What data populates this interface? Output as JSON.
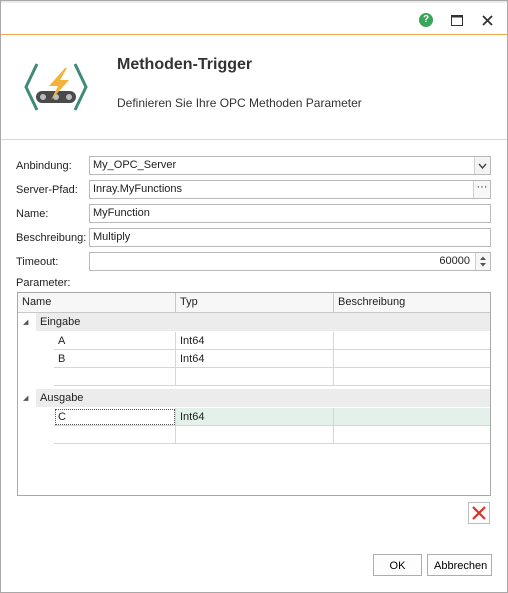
{
  "window": {
    "title": "Methoden-Trigger",
    "subtitle": "Definieren Sie Ihre OPC Methoden Parameter",
    "help_icon": "help-icon",
    "maximize_icon": "maximize-icon",
    "close_icon": "close-icon",
    "accent_color": "#f0a54a"
  },
  "form": {
    "binding": {
      "label": "Anbindung:",
      "value": "My_OPC_Server"
    },
    "server_path": {
      "label": "Server-Pfad:",
      "value": "Inray.MyFunctions",
      "browse_label": "···"
    },
    "name": {
      "label": "Name:",
      "value": "MyFunction"
    },
    "description": {
      "label": "Beschreibung:",
      "value": "Multiply"
    },
    "timeout": {
      "label": "Timeout:",
      "value": "60000"
    },
    "parameters_label": "Parameter:"
  },
  "grid": {
    "columns": [
      "Name",
      "Typ",
      "Beschreibung"
    ],
    "groups": [
      {
        "name": "Eingabe",
        "rows": [
          {
            "name": "A",
            "type": "Int64",
            "description": ""
          },
          {
            "name": "B",
            "type": "Int64",
            "description": ""
          },
          {
            "name": "",
            "type": "",
            "description": ""
          }
        ]
      },
      {
        "name": "Ausgabe",
        "rows": [
          {
            "name": "C",
            "type": "Int64",
            "description": ""
          },
          {
            "name": "",
            "type": "",
            "description": ""
          }
        ]
      }
    ],
    "selected_row_color": "#e3f1ea"
  },
  "buttons": {
    "delete_icon": "delete-icon",
    "ok": "OK",
    "cancel": "Abbrechen"
  }
}
